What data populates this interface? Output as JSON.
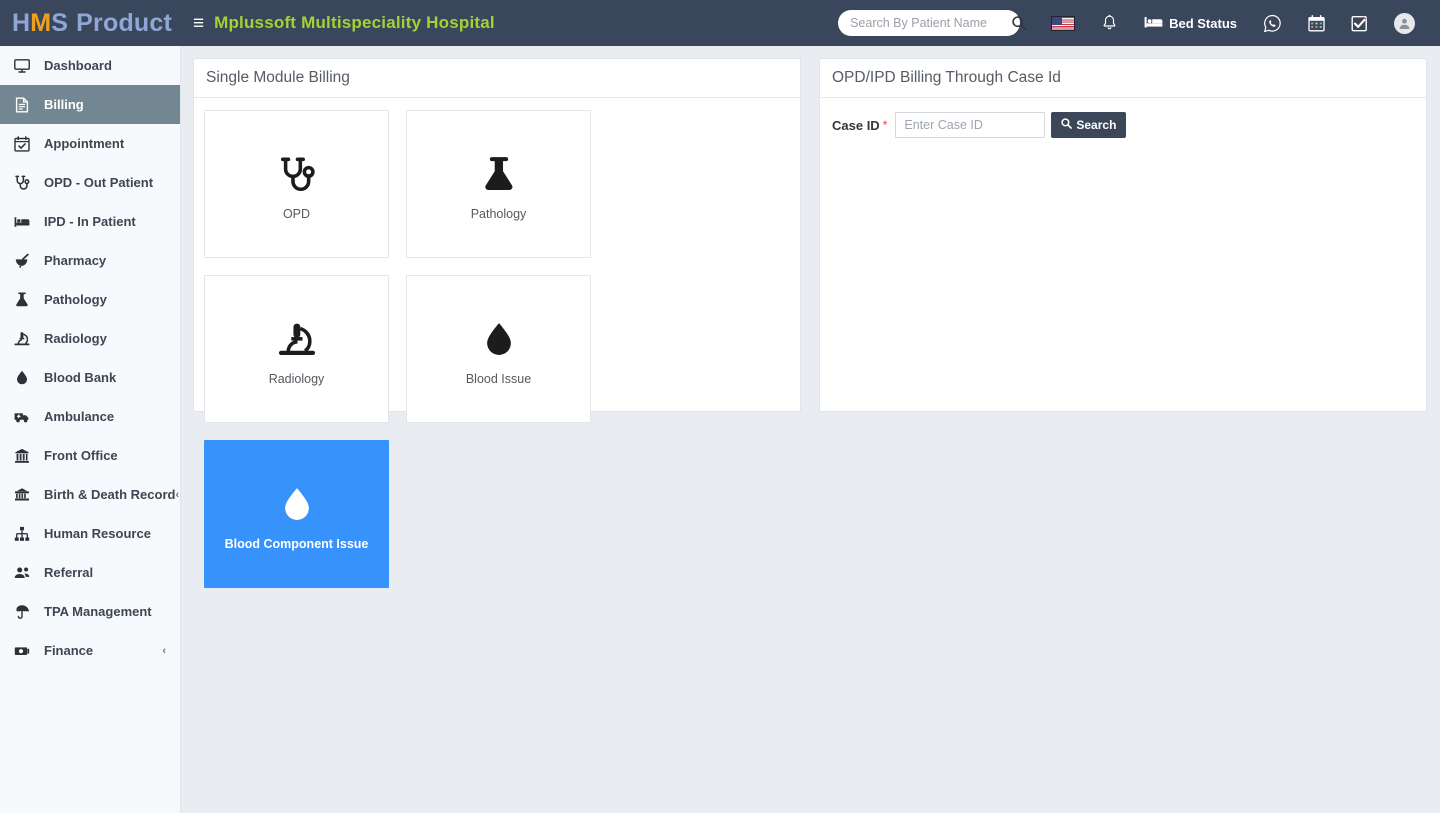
{
  "header": {
    "logo": {
      "part1": "H",
      "part2": "M",
      "part3": "S",
      "part4": "Product"
    },
    "hamburger": "≡",
    "hospital_name": "Mplussoft Multispeciality Hospital",
    "search": {
      "placeholder": "Search By Patient Name",
      "value": ""
    },
    "flag_icon": "us-flag-icon",
    "bell_icon": "bell-icon",
    "bed_status_label": "Bed Status",
    "whatsapp_icon": "whatsapp-icon",
    "calendar_icon": "calendar-icon",
    "checkbox_icon": "checkbox-icon",
    "avatar_icon": "user-avatar-icon"
  },
  "sidebar": {
    "items": [
      {
        "label": "Dashboard",
        "icon": "monitor-icon",
        "active": false,
        "caret": ""
      },
      {
        "label": "Billing",
        "icon": "file-invoice-icon",
        "active": true,
        "caret": ""
      },
      {
        "label": "Appointment",
        "icon": "calendar-check-icon",
        "active": false,
        "caret": ""
      },
      {
        "label": "OPD - Out Patient",
        "icon": "stethoscope-icon",
        "active": false,
        "caret": ""
      },
      {
        "label": "IPD - In Patient",
        "icon": "hospital-bed-icon",
        "active": false,
        "caret": ""
      },
      {
        "label": "Pharmacy",
        "icon": "mortar-pestle-icon",
        "active": false,
        "caret": ""
      },
      {
        "label": "Pathology",
        "icon": "flask-icon",
        "active": false,
        "caret": ""
      },
      {
        "label": "Radiology",
        "icon": "microscope-icon",
        "active": false,
        "caret": ""
      },
      {
        "label": "Blood Bank",
        "icon": "blood-drop-icon",
        "active": false,
        "caret": ""
      },
      {
        "label": "Ambulance",
        "icon": "ambulance-icon",
        "active": false,
        "caret": ""
      },
      {
        "label": "Front Office",
        "icon": "building-icon",
        "active": false,
        "caret": ""
      },
      {
        "label": "Birth & Death Record",
        "icon": "archive-icon",
        "active": false,
        "caret": "‹"
      },
      {
        "label": "Human Resource",
        "icon": "sitemap-icon",
        "active": false,
        "caret": ""
      },
      {
        "label": "Referral",
        "icon": "users-icon",
        "active": false,
        "caret": ""
      },
      {
        "label": "TPA Management",
        "icon": "umbrella-icon",
        "active": false,
        "caret": ""
      },
      {
        "label": "Finance",
        "icon": "money-icon",
        "active": false,
        "caret": "‹"
      }
    ]
  },
  "main": {
    "left_panel": {
      "title": "Single Module Billing",
      "cards": [
        {
          "label": "OPD",
          "icon": "stethoscope-icon",
          "selected": false
        },
        {
          "label": "Pathology",
          "icon": "flask-icon",
          "selected": false
        },
        {
          "label": "Radiology",
          "icon": "microscope-icon",
          "selected": false
        },
        {
          "label": "Blood Issue",
          "icon": "blood-drop-icon",
          "selected": false
        },
        {
          "label": "Blood Component Issue",
          "icon": "blood-drop-icon",
          "selected": true
        }
      ]
    },
    "right_panel": {
      "title": "OPD/IPD Billing Through Case Id",
      "case_id_label": "Case ID",
      "required_marker": "*",
      "case_id_placeholder": "Enter Case ID",
      "case_id_value": "",
      "search_button_label": "Search"
    }
  },
  "colors": {
    "header_bg": "#3a465c",
    "sidebar_bg": "#f7fafc",
    "sidebar_active_bg": "#728792",
    "accent_blue": "#3892fb",
    "hospital_name": "#a4d232",
    "logo_blue": "#8fa7d4",
    "logo_amber": "#f0a01e",
    "content_bg": "#e9ecf1",
    "button_dark": "#3b4758",
    "required_red": "#e0443e"
  }
}
